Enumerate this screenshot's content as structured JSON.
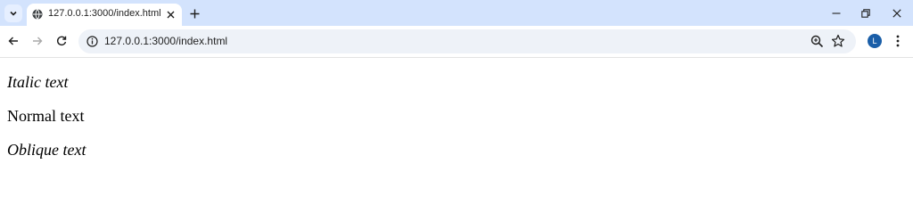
{
  "browser": {
    "tab": {
      "title": "127.0.0.1:3000/index.html"
    },
    "address_bar": {
      "url": "127.0.0.1:3000/index.html"
    },
    "profile": {
      "initial": "L",
      "color": "#1a5ea8"
    },
    "theme": {
      "tabstrip_color": "#d3e3fd",
      "omnibox_color": "#eef2f8"
    }
  },
  "page": {
    "paragraphs": [
      {
        "text": "Italic text",
        "style": "italic"
      },
      {
        "text": "Normal text",
        "style": "normal"
      },
      {
        "text": "Oblique text",
        "style": "oblique"
      }
    ]
  }
}
